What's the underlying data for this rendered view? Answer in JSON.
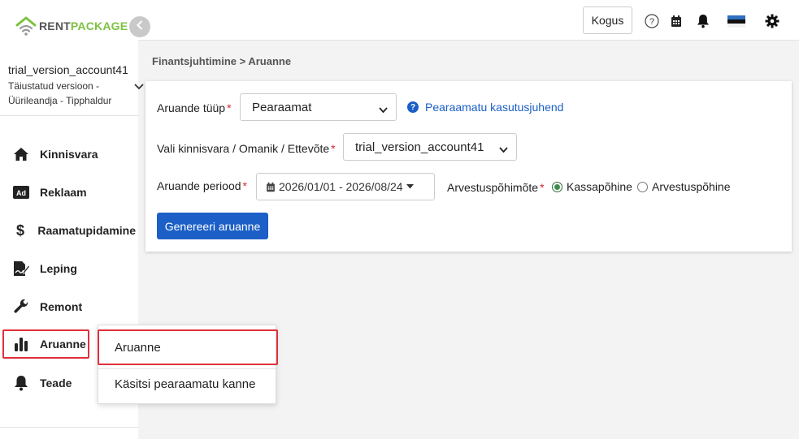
{
  "sidebar": {
    "logo": {
      "part1": "RENT",
      "part2": "PACKAGE"
    },
    "account": {
      "name": "trial_version_account41",
      "desc": "Täiustatud versioon - Üürileandja - Tipphaldur"
    },
    "items": [
      {
        "label": "Kinnisvara",
        "icon": "home-icon"
      },
      {
        "label": "Reklaam",
        "icon": "ad-icon"
      },
      {
        "label": "Raamatupidamine",
        "icon": "dollar-icon"
      },
      {
        "label": "Leping",
        "icon": "contract-icon"
      },
      {
        "label": "Remont",
        "icon": "wrench-icon"
      },
      {
        "label": "Aruanne",
        "icon": "bar-chart-icon"
      },
      {
        "label": "Teade",
        "icon": "bell-icon"
      }
    ]
  },
  "submenu": {
    "items": [
      {
        "label": "Aruanne"
      },
      {
        "label": "Käsitsi pearaamatu kanne"
      }
    ]
  },
  "topbar": {
    "kogus_label": "Kogus",
    "icons": [
      "help-icon",
      "calendar-icon",
      "bell-icon",
      "estonia-flag-icon",
      "gear-icon"
    ]
  },
  "breadcrumb": "Finantsjuhtimine > Aruanne",
  "form": {
    "report_type": {
      "label": "Aruande tüüp",
      "required": "*",
      "value": "Pearaamat"
    },
    "help_link": "Pearaamatu kasutusjuhend",
    "property": {
      "label": "Vali kinnisvara / Omanik / Ettevõte",
      "required": "*",
      "value": "trial_version_account41"
    },
    "period": {
      "label": "Aruande periood",
      "required": "*",
      "value": "2026/01/01 - 2026/08/24"
    },
    "principle": {
      "label": "Arvestuspõhimõte",
      "required": "*",
      "options": [
        "Kassapõhine",
        "Arvestuspõhine"
      ],
      "selected": "Kassapõhine"
    },
    "generate_label": "Genereeri aruanne"
  },
  "colors": {
    "accent": "#1b5fc7",
    "brand_green": "#7cc242",
    "highlight": "#e0303a"
  }
}
